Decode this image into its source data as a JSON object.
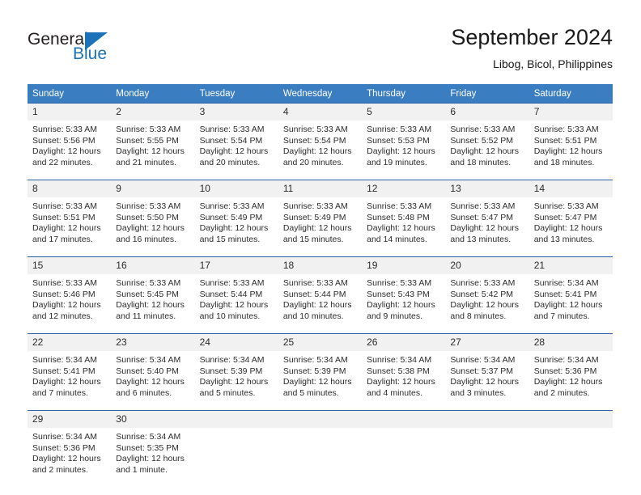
{
  "brand": {
    "name_top": "General",
    "name_bottom": "Blue",
    "color_primary": "#1b72b8",
    "color_text": "#231f20"
  },
  "header": {
    "title": "September 2024",
    "subtitle": "Libog, Bicol, Philippines"
  },
  "theme": {
    "header_bg": "#3a7dc0",
    "header_text": "#ffffff",
    "row_rule": "#2a62a8",
    "daynum_bg": "#f1f1f1",
    "body_text": "#2b2b2b"
  },
  "weekdays": [
    "Sunday",
    "Monday",
    "Tuesday",
    "Wednesday",
    "Thursday",
    "Friday",
    "Saturday"
  ],
  "weeks": [
    [
      {
        "day": "1",
        "sunrise": "Sunrise: 5:33 AM",
        "sunset": "Sunset: 5:56 PM",
        "daylight1": "Daylight: 12 hours",
        "daylight2": "and 22 minutes."
      },
      {
        "day": "2",
        "sunrise": "Sunrise: 5:33 AM",
        "sunset": "Sunset: 5:55 PM",
        "daylight1": "Daylight: 12 hours",
        "daylight2": "and 21 minutes."
      },
      {
        "day": "3",
        "sunrise": "Sunrise: 5:33 AM",
        "sunset": "Sunset: 5:54 PM",
        "daylight1": "Daylight: 12 hours",
        "daylight2": "and 20 minutes."
      },
      {
        "day": "4",
        "sunrise": "Sunrise: 5:33 AM",
        "sunset": "Sunset: 5:54 PM",
        "daylight1": "Daylight: 12 hours",
        "daylight2": "and 20 minutes."
      },
      {
        "day": "5",
        "sunrise": "Sunrise: 5:33 AM",
        "sunset": "Sunset: 5:53 PM",
        "daylight1": "Daylight: 12 hours",
        "daylight2": "and 19 minutes."
      },
      {
        "day": "6",
        "sunrise": "Sunrise: 5:33 AM",
        "sunset": "Sunset: 5:52 PM",
        "daylight1": "Daylight: 12 hours",
        "daylight2": "and 18 minutes."
      },
      {
        "day": "7",
        "sunrise": "Sunrise: 5:33 AM",
        "sunset": "Sunset: 5:51 PM",
        "daylight1": "Daylight: 12 hours",
        "daylight2": "and 18 minutes."
      }
    ],
    [
      {
        "day": "8",
        "sunrise": "Sunrise: 5:33 AM",
        "sunset": "Sunset: 5:51 PM",
        "daylight1": "Daylight: 12 hours",
        "daylight2": "and 17 minutes."
      },
      {
        "day": "9",
        "sunrise": "Sunrise: 5:33 AM",
        "sunset": "Sunset: 5:50 PM",
        "daylight1": "Daylight: 12 hours",
        "daylight2": "and 16 minutes."
      },
      {
        "day": "10",
        "sunrise": "Sunrise: 5:33 AM",
        "sunset": "Sunset: 5:49 PM",
        "daylight1": "Daylight: 12 hours",
        "daylight2": "and 15 minutes."
      },
      {
        "day": "11",
        "sunrise": "Sunrise: 5:33 AM",
        "sunset": "Sunset: 5:49 PM",
        "daylight1": "Daylight: 12 hours",
        "daylight2": "and 15 minutes."
      },
      {
        "day": "12",
        "sunrise": "Sunrise: 5:33 AM",
        "sunset": "Sunset: 5:48 PM",
        "daylight1": "Daylight: 12 hours",
        "daylight2": "and 14 minutes."
      },
      {
        "day": "13",
        "sunrise": "Sunrise: 5:33 AM",
        "sunset": "Sunset: 5:47 PM",
        "daylight1": "Daylight: 12 hours",
        "daylight2": "and 13 minutes."
      },
      {
        "day": "14",
        "sunrise": "Sunrise: 5:33 AM",
        "sunset": "Sunset: 5:47 PM",
        "daylight1": "Daylight: 12 hours",
        "daylight2": "and 13 minutes."
      }
    ],
    [
      {
        "day": "15",
        "sunrise": "Sunrise: 5:33 AM",
        "sunset": "Sunset: 5:46 PM",
        "daylight1": "Daylight: 12 hours",
        "daylight2": "and 12 minutes."
      },
      {
        "day": "16",
        "sunrise": "Sunrise: 5:33 AM",
        "sunset": "Sunset: 5:45 PM",
        "daylight1": "Daylight: 12 hours",
        "daylight2": "and 11 minutes."
      },
      {
        "day": "17",
        "sunrise": "Sunrise: 5:33 AM",
        "sunset": "Sunset: 5:44 PM",
        "daylight1": "Daylight: 12 hours",
        "daylight2": "and 10 minutes."
      },
      {
        "day": "18",
        "sunrise": "Sunrise: 5:33 AM",
        "sunset": "Sunset: 5:44 PM",
        "daylight1": "Daylight: 12 hours",
        "daylight2": "and 10 minutes."
      },
      {
        "day": "19",
        "sunrise": "Sunrise: 5:33 AM",
        "sunset": "Sunset: 5:43 PM",
        "daylight1": "Daylight: 12 hours",
        "daylight2": "and 9 minutes."
      },
      {
        "day": "20",
        "sunrise": "Sunrise: 5:33 AM",
        "sunset": "Sunset: 5:42 PM",
        "daylight1": "Daylight: 12 hours",
        "daylight2": "and 8 minutes."
      },
      {
        "day": "21",
        "sunrise": "Sunrise: 5:34 AM",
        "sunset": "Sunset: 5:41 PM",
        "daylight1": "Daylight: 12 hours",
        "daylight2": "and 7 minutes."
      }
    ],
    [
      {
        "day": "22",
        "sunrise": "Sunrise: 5:34 AM",
        "sunset": "Sunset: 5:41 PM",
        "daylight1": "Daylight: 12 hours",
        "daylight2": "and 7 minutes."
      },
      {
        "day": "23",
        "sunrise": "Sunrise: 5:34 AM",
        "sunset": "Sunset: 5:40 PM",
        "daylight1": "Daylight: 12 hours",
        "daylight2": "and 6 minutes."
      },
      {
        "day": "24",
        "sunrise": "Sunrise: 5:34 AM",
        "sunset": "Sunset: 5:39 PM",
        "daylight1": "Daylight: 12 hours",
        "daylight2": "and 5 minutes."
      },
      {
        "day": "25",
        "sunrise": "Sunrise: 5:34 AM",
        "sunset": "Sunset: 5:39 PM",
        "daylight1": "Daylight: 12 hours",
        "daylight2": "and 5 minutes."
      },
      {
        "day": "26",
        "sunrise": "Sunrise: 5:34 AM",
        "sunset": "Sunset: 5:38 PM",
        "daylight1": "Daylight: 12 hours",
        "daylight2": "and 4 minutes."
      },
      {
        "day": "27",
        "sunrise": "Sunrise: 5:34 AM",
        "sunset": "Sunset: 5:37 PM",
        "daylight1": "Daylight: 12 hours",
        "daylight2": "and 3 minutes."
      },
      {
        "day": "28",
        "sunrise": "Sunrise: 5:34 AM",
        "sunset": "Sunset: 5:36 PM",
        "daylight1": "Daylight: 12 hours",
        "daylight2": "and 2 minutes."
      }
    ],
    [
      {
        "day": "29",
        "sunrise": "Sunrise: 5:34 AM",
        "sunset": "Sunset: 5:36 PM",
        "daylight1": "Daylight: 12 hours",
        "daylight2": "and 2 minutes."
      },
      {
        "day": "30",
        "sunrise": "Sunrise: 5:34 AM",
        "sunset": "Sunset: 5:35 PM",
        "daylight1": "Daylight: 12 hours",
        "daylight2": "and 1 minute."
      },
      {
        "day": "",
        "sunrise": "",
        "sunset": "",
        "daylight1": "",
        "daylight2": ""
      },
      {
        "day": "",
        "sunrise": "",
        "sunset": "",
        "daylight1": "",
        "daylight2": ""
      },
      {
        "day": "",
        "sunrise": "",
        "sunset": "",
        "daylight1": "",
        "daylight2": ""
      },
      {
        "day": "",
        "sunrise": "",
        "sunset": "",
        "daylight1": "",
        "daylight2": ""
      },
      {
        "day": "",
        "sunrise": "",
        "sunset": "",
        "daylight1": "",
        "daylight2": ""
      }
    ]
  ]
}
